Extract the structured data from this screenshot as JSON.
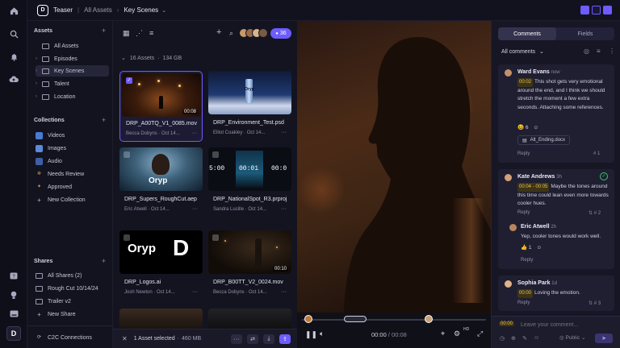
{
  "topbar": {
    "logo": "D",
    "project": "Teaser",
    "breadcrumb_1": "All Assets",
    "breadcrumb_2": "Key Scenes"
  },
  "sidebar": {
    "assets_heading": "Assets",
    "assets_items": [
      {
        "label": "All Assets"
      },
      {
        "label": "Episodes"
      },
      {
        "label": "Key Scenes"
      },
      {
        "label": "Talent"
      },
      {
        "label": "Location"
      }
    ],
    "collections_heading": "Collections",
    "collections_items": [
      {
        "label": "Videos"
      },
      {
        "label": "Images"
      },
      {
        "label": "Audio"
      },
      {
        "label": "Needs Review"
      },
      {
        "label": "Approved"
      },
      {
        "label": "New Collection"
      }
    ],
    "shares_heading": "Shares",
    "shares_items": [
      {
        "label": "All Shares (2)"
      },
      {
        "label": "Rough Cut 10/14/24"
      },
      {
        "label": "Trailer v2"
      },
      {
        "label": "New Share"
      }
    ],
    "footer": "C2C Connections"
  },
  "grid": {
    "member_count": "36",
    "assets_count": "16 Assets",
    "assets_size": "134 GB",
    "cards": [
      {
        "title": "DRP_A00TQ_V1_0085.mov",
        "author": "Becca Dobyns",
        "date": "Oct 14...",
        "duration": "00:08"
      },
      {
        "title": "DRP_Environment_Test.psd",
        "author": "Elliot Coakley",
        "date": "Oct 14...",
        "duration": ""
      },
      {
        "title": "DRP_Supers_RoughCut.aep",
        "author": "Eric Atwell",
        "date": "Oct 14...",
        "duration": ""
      },
      {
        "title": "DRP_NationalSpot_R3.prproj",
        "author": "Sandra Lucille",
        "date": "Oct 14...",
        "duration": ""
      },
      {
        "title": "DRP_Logos.ai",
        "author": "Josh Newton",
        "date": "Oct 14...",
        "duration": ""
      },
      {
        "title": "DRP_B00TT_V2_0024.mov",
        "author": "Becca Dobyns",
        "date": "Oct 14...",
        "duration": "00:10"
      }
    ],
    "thumb_texts": {
      "oryp": "Oryp",
      "oryp2": "Oryp",
      "logo_d": "D",
      "tc1": "5:00",
      "tc2": "00:01",
      "tc3": "00:0",
      "bottle": "Oryp"
    },
    "selection_label": "1 Asset selected",
    "selection_size": "460 MB"
  },
  "viewer": {
    "time_current": "00:00",
    "time_total": "00:08",
    "quality": "HD"
  },
  "comments": {
    "tab_comments": "Comments",
    "tab_fields": "Fields",
    "filter_label": "All comments",
    "list": [
      {
        "name": "Ward Evans",
        "ago": "now",
        "timecode": "00:02",
        "text": "This shot gets very emotional around the end, and I think we should stretch the moment a few extra seconds. Attaching some references.",
        "reaction": "😆 6",
        "attachment": "Alt_Ending.docx",
        "reply": "Reply",
        "num": "# 1"
      },
      {
        "name": "Kate Andrews",
        "ago": "3h",
        "timecode": "00:04 - 00:05",
        "text": "Maybe the tones around this time could lean even more towards cooler hues.",
        "reply": "Reply",
        "num": "# 2"
      },
      {
        "name": "Eric Atwell",
        "ago": "2h",
        "text": "Yep, cooler tones would work well.",
        "reaction": "👍 1",
        "reply": "Reply"
      },
      {
        "name": "Sophia Park",
        "ago": "1d",
        "timecode": "00:00",
        "text": "Loving the emotion.",
        "reply": "Reply",
        "num": "# 3"
      }
    ],
    "composer_timecode": "00:00",
    "composer_placeholder": "Leave your comment...",
    "composer_visibility": "Public"
  },
  "colors": {
    "accent": "#6d5cff",
    "timecode": "#e7c34c",
    "resolved": "#3fc46f"
  }
}
